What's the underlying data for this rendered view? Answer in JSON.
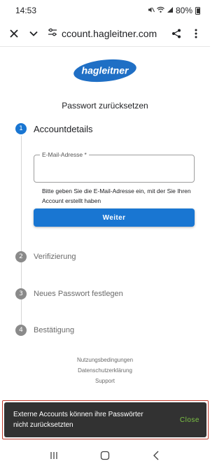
{
  "status_bar": {
    "time": "14:53",
    "battery": "80%"
  },
  "toolbar": {
    "url": "ccount.hagleitner.com"
  },
  "logo": {
    "text": "hagleitner",
    "color": "#1f6fc5"
  },
  "page": {
    "title": "Passwort zurücksetzen"
  },
  "steps": [
    {
      "number": "1",
      "label": "Accountdetails"
    },
    {
      "number": "2",
      "label": "Verifizierung"
    },
    {
      "number": "3",
      "label": "Neues Passwort festlegen"
    },
    {
      "number": "4",
      "label": "Bestätigung"
    }
  ],
  "email_field": {
    "label": "E-Mail-Adresse *",
    "value": "",
    "helper": "Bitte geben Sie die E-Mail-Adresse ein, mit der Sie Ihren Account erstellt haben"
  },
  "primary_button": {
    "label": "Weiter"
  },
  "footer_links": [
    "Nutzungsbedingungen",
    "Datenschutzerklärung",
    "Support"
  ],
  "snackbar": {
    "message": "Externe Accounts können ihre Passwörter nicht zurücksetzten",
    "action": "Close"
  },
  "colors": {
    "primary": "#1976d2",
    "snackbar_bg": "#323232",
    "snackbar_action": "#7cc245",
    "inactive_step": "#8a8a8a"
  }
}
